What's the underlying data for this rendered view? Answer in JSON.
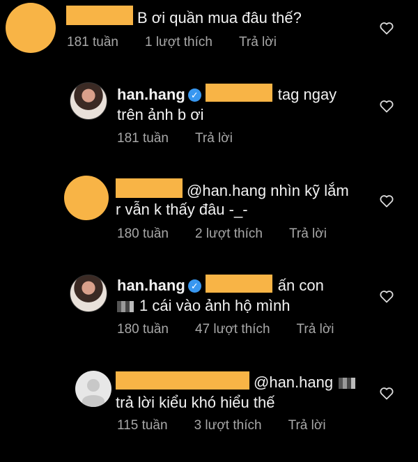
{
  "comments": [
    {
      "text": "B ơi quần mua đâu thế?",
      "time": "181 tuần",
      "likes": "1 lượt thích",
      "reply": "Trả lời"
    },
    {
      "username": "han.hang",
      "verified_glyph": "✓",
      "text_line1": "tag ngay",
      "text_line2": "trên ảnh b ơi",
      "time": "181 tuần",
      "reply": "Trả lời"
    },
    {
      "text_line1": "@han.hang nhìn kỹ lắm",
      "text_line2": "r vẫn k thấy đâu -_-",
      "time": "180 tuần",
      "likes": "2 lượt thích",
      "reply": "Trả lời"
    },
    {
      "username": "han.hang",
      "verified_glyph": "✓",
      "text_line1": "ấn con",
      "text_line2": "1 cái vào ảnh hộ mình",
      "time": "180 tuần",
      "likes": "47 lượt thích",
      "reply": "Trả lời"
    },
    {
      "text_line1": "@han.hang",
      "text_line2": "trả lời kiểu khó hiểu thế",
      "time": "115 tuần",
      "likes": "3 lượt thích",
      "reply": "Trả lời"
    }
  ],
  "icons": {
    "like": "heart-outline-icon",
    "verified": "verified-badge-icon"
  },
  "colors": {
    "background": "#000000",
    "redaction": "#f8b446",
    "meta_text": "#a8a8a8",
    "verified": "#3897f0"
  }
}
